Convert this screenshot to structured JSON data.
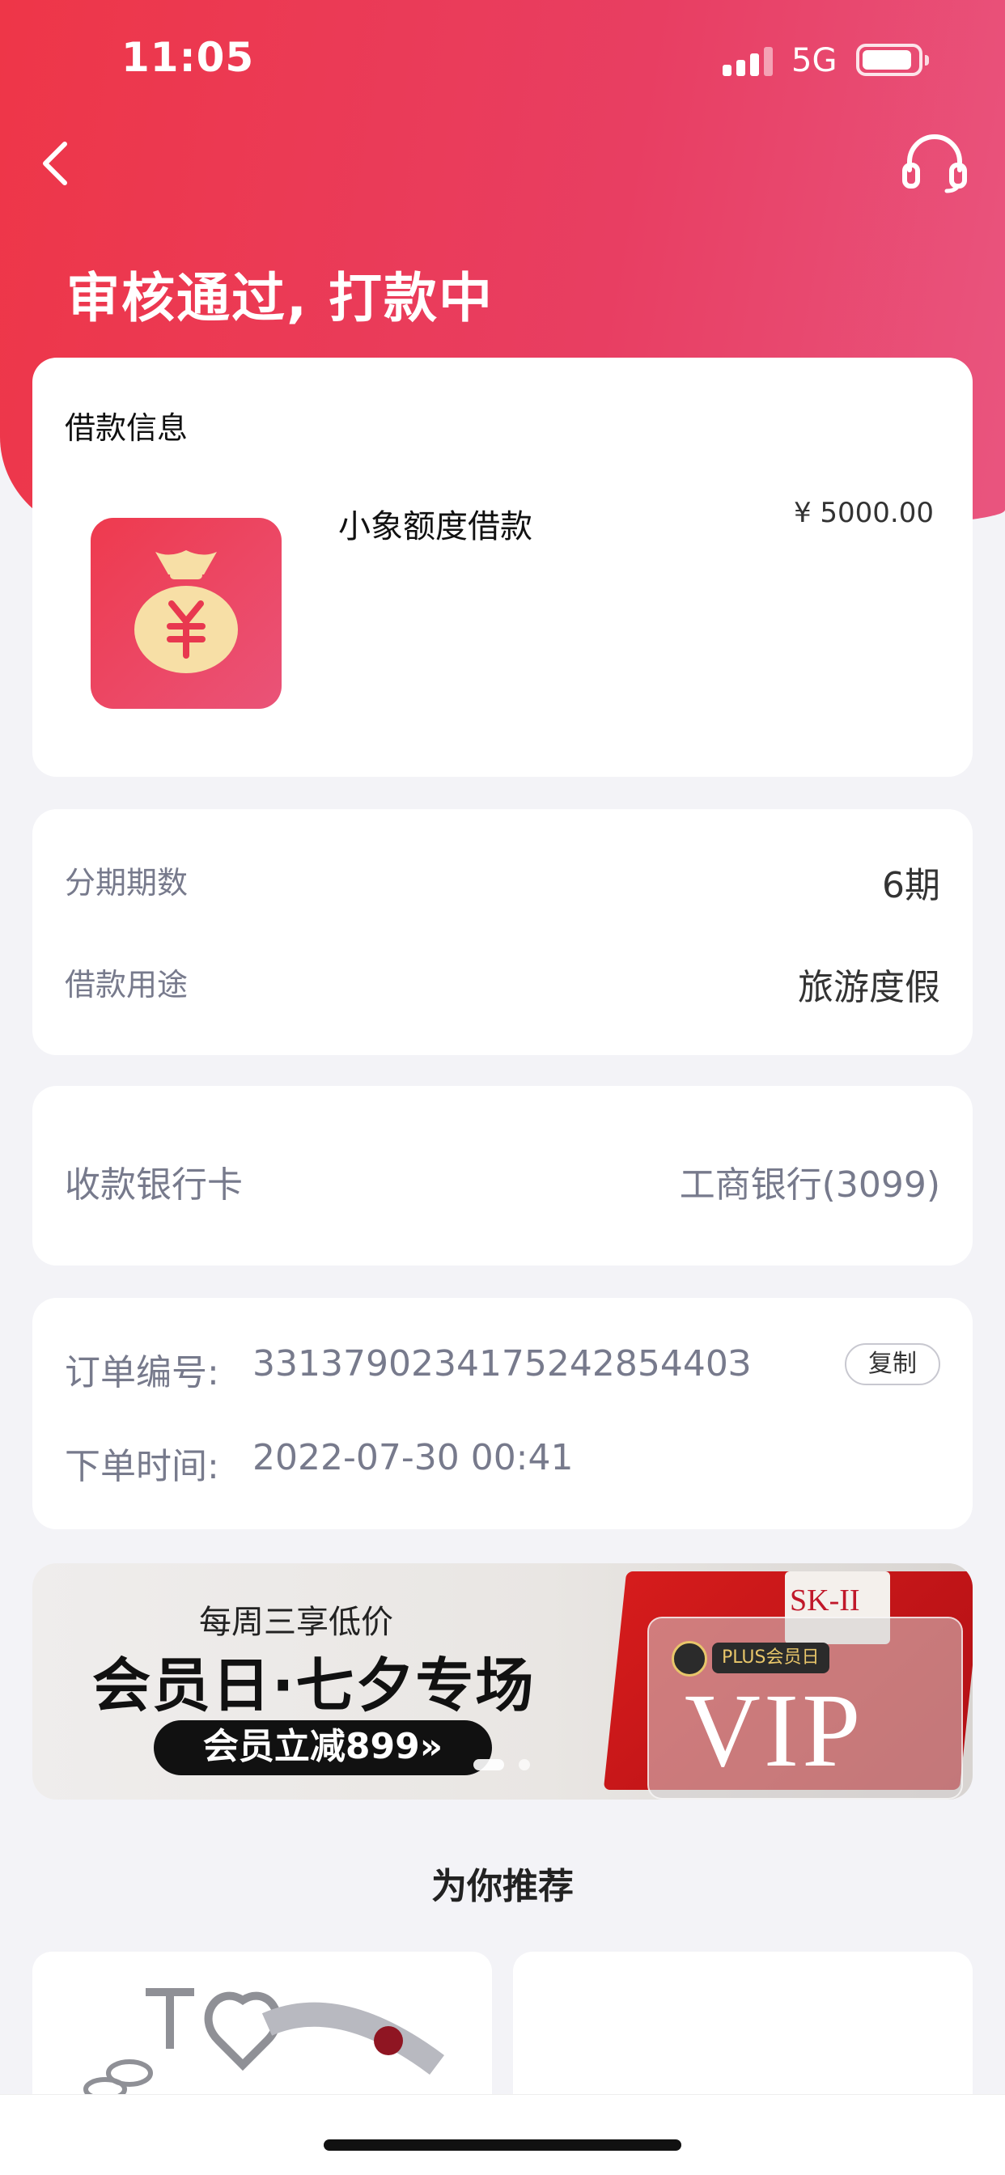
{
  "status_bar": {
    "time": "11:05",
    "network": "5G"
  },
  "header": {
    "title": "审核通过, 打款中"
  },
  "loan_info": {
    "section_title": "借款信息",
    "product_name": "小象额度借款",
    "amount": "¥ 5000.00"
  },
  "details": {
    "installments_label": "分期期数",
    "installments_value": "6期",
    "purpose_label": "借款用途",
    "purpose_value": "旅游度假"
  },
  "bank": {
    "label": "收款银行卡",
    "value": "工商银行(3099)"
  },
  "order": {
    "number_label": "订单编号:",
    "number_value": "331379023417524285440З",
    "copy_button": "复制",
    "time_label": "下单时间:",
    "time_value": "2022-07-30 00:41"
  },
  "banner": {
    "subtitle": "每周三享低价",
    "title": "会员日·七夕专场",
    "cta": "会员立减899»",
    "badge": "PLUS会员日",
    "brand": "VIP",
    "pack_text": "SK-II"
  },
  "recommend": {
    "title": "为你推荐"
  },
  "colors": {
    "brand_red": "#ee3648",
    "brand_pink": "#e9557f"
  },
  "icons": {
    "back": "chevron-left-icon",
    "service": "headset-icon",
    "loan": "money-bag-icon"
  }
}
